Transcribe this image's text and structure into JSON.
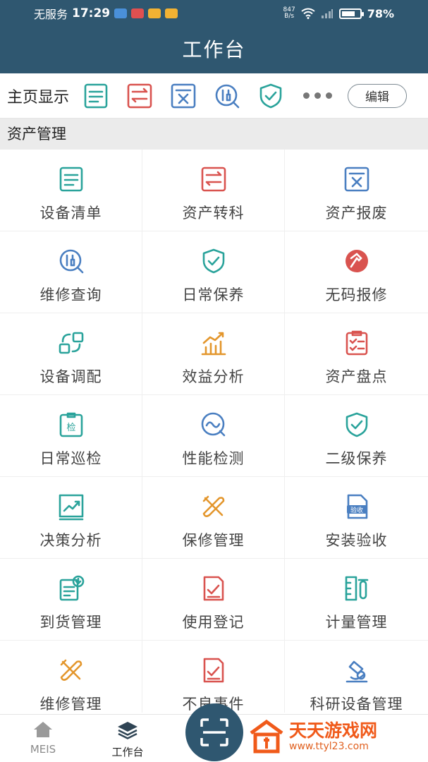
{
  "status_bar": {
    "carrier": "无服务",
    "time": "17:29",
    "net_speed_value": "847",
    "net_speed_unit": "B/s",
    "battery": "78%",
    "battery_level": 0.78
  },
  "header": {
    "title": "工作台"
  },
  "home_display": {
    "label": "主页显示",
    "icons": [
      "list-icon",
      "transfer-icon",
      "scrap-icon",
      "repair-search-icon",
      "shield-check-icon"
    ],
    "more": "more-dots-icon",
    "edit_label": "编辑"
  },
  "section": {
    "title": "资产管理"
  },
  "grid_items": [
    {
      "label": "设备清单",
      "icon": "list-icon",
      "color": "#2aa39b"
    },
    {
      "label": "资产转科",
      "icon": "transfer-icon",
      "color": "#d9534f"
    },
    {
      "label": "资产报废",
      "icon": "scrap-icon",
      "color": "#4a7fc1"
    },
    {
      "label": "维修查询",
      "icon": "repair-search-icon",
      "color": "#4a7fc1"
    },
    {
      "label": "日常保养",
      "icon": "shield-check-icon",
      "color": "#2aa39b"
    },
    {
      "label": "无码报修",
      "icon": "hammer-icon",
      "color": "#d9534f"
    },
    {
      "label": "设备调配",
      "icon": "swap-icon",
      "color": "#2aa39b"
    },
    {
      "label": "效益分析",
      "icon": "bar-trend-icon",
      "color": "#e3962c"
    },
    {
      "label": "资产盘点",
      "icon": "clipboard-check-icon",
      "color": "#d9534f"
    },
    {
      "label": "日常巡检",
      "icon": "inspect-icon",
      "color": "#2aa39b",
      "badge": "检"
    },
    {
      "label": "性能检测",
      "icon": "wave-icon",
      "color": "#4a7fc1"
    },
    {
      "label": "二级保养",
      "icon": "shield-check-icon",
      "color": "#2aa39b"
    },
    {
      "label": "决策分析",
      "icon": "line-chart-icon",
      "color": "#2aa39b"
    },
    {
      "label": "保修管理",
      "icon": "tools-icon",
      "color": "#e3962c"
    },
    {
      "label": "安装验收",
      "icon": "acceptance-icon",
      "color": "#4a7fc1",
      "badge": "验收"
    },
    {
      "label": "到货管理",
      "icon": "arrival-icon",
      "color": "#2aa39b"
    },
    {
      "label": "使用登记",
      "icon": "register-icon",
      "color": "#d9534f"
    },
    {
      "label": "计量管理",
      "icon": "measure-icon",
      "color": "#2aa39b"
    },
    {
      "label": "维修管理",
      "icon": "tools-icon",
      "color": "#e3962c"
    },
    {
      "label": "不良事件",
      "icon": "register-icon",
      "color": "#d9534f"
    },
    {
      "label": "科研设备管理",
      "icon": "microscope-icon",
      "color": "#4a7fc1"
    }
  ],
  "tabbar": {
    "tabs": [
      {
        "label": "MEIS",
        "icon": "home-icon"
      },
      {
        "label": "工作台",
        "icon": "layers-icon"
      }
    ],
    "scan_icon": "scan-icon"
  },
  "watermark": {
    "name": "天天游戏网",
    "url": "www.ttyl23.com"
  },
  "colors": {
    "header_bg": "#2f5770",
    "teal": "#2aa39b",
    "red": "#d9534f",
    "blue": "#4a7fc1",
    "orange": "#e3962c"
  }
}
